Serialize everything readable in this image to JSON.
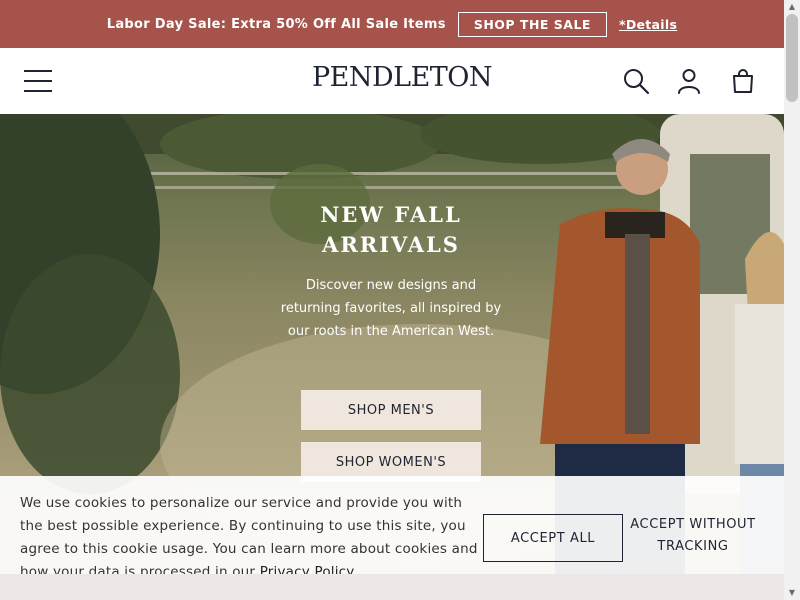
{
  "promo": {
    "text": "Labor Day Sale: Extra 50% Off All Sale Items",
    "button_label": "SHOP THE SALE",
    "details_label": "*Details"
  },
  "header": {
    "logo_text": "PENDLETON",
    "icons": [
      "hamburger-menu-icon",
      "search-icon",
      "account-icon",
      "shopping-bag-icon"
    ]
  },
  "hero": {
    "title": "NEW FALL\nARRIVALS",
    "description": "Discover new designs and returning favorites, all inspired by our roots in the American West.",
    "buttons": [
      {
        "label": "SHOP MEN'S"
      },
      {
        "label": "SHOP WOMEN'S"
      }
    ]
  },
  "cookie_banner": {
    "text": "We use cookies to personalize our service and provide you with the best possible experience. By continuing to use this site, you agree to this cookie usage. You can learn more about cookies and how your data is processed in our",
    "link_label": "Privacy Policy",
    "accept_all_label": "ACCEPT ALL",
    "accept_without_tracking_label": "ACCEPT WITHOUT TRACKING"
  },
  "colors": {
    "promo_bg": "#a5534b",
    "brand_navy": "#1f2332",
    "button_cream": "#efe7dd"
  }
}
